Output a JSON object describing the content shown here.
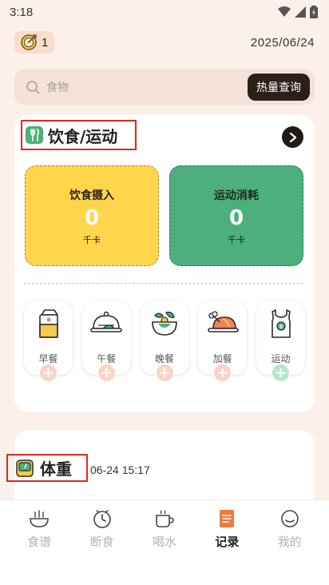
{
  "status": {
    "time": "3:18"
  },
  "header": {
    "streak_count": "1",
    "date": "2025/06/24"
  },
  "search": {
    "placeholder": "食物",
    "button": "热量查询"
  },
  "diet_card": {
    "title": "饮食/运动",
    "intake": {
      "label": "饮食摄入",
      "value": "0",
      "unit": "千卡"
    },
    "burn": {
      "label": "运动消耗",
      "value": "0",
      "unit": "千卡"
    },
    "meals": [
      {
        "label": "早餐",
        "icon": "milk-carton-icon"
      },
      {
        "label": "午餐",
        "icon": "dish-cloche-icon"
      },
      {
        "label": "晚餐",
        "icon": "salad-bowl-icon"
      },
      {
        "label": "加餐",
        "icon": "roast-chicken-icon"
      },
      {
        "label": "运动",
        "icon": "tank-top-icon"
      }
    ]
  },
  "weight_card": {
    "title": "体重",
    "timestamp": "06-24 15:17"
  },
  "tabs": [
    {
      "label": "食谱",
      "icon": "bowl-icon",
      "active": false
    },
    {
      "label": "断食",
      "icon": "clock-icon",
      "active": false
    },
    {
      "label": "喝水",
      "icon": "cup-icon",
      "active": false
    },
    {
      "label": "记录",
      "icon": "notebook-icon",
      "active": true
    },
    {
      "label": "我的",
      "icon": "smile-icon",
      "active": false
    }
  ],
  "colors": {
    "background": "#fbf0ea",
    "intake_card": "#ffd54c",
    "burn_card": "#4caf7c",
    "accent_dark": "#2b1f19",
    "active_tab_icon": "#f07a3c",
    "highlight_outline": "#e0281e"
  }
}
